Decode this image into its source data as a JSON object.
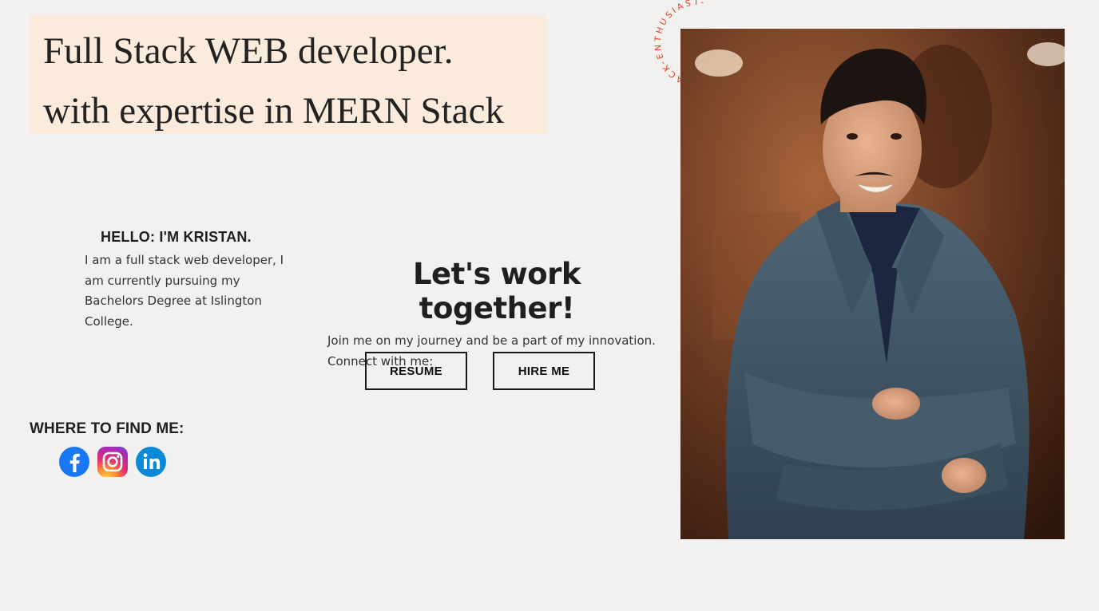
{
  "hero": {
    "line1": "Full Stack WEB developer.",
    "line2": "with expertise in MERN Stack"
  },
  "badge": {
    "text": "MERN STACK-ENTHUSIAST-",
    "color": "#e2401c"
  },
  "intro": {
    "title": "HELLO: I'M KRISTAN.",
    "text": "I am a full stack web developer, I am currently pursuing my Bachelors Degree at Islington College."
  },
  "cta": {
    "title": "Let's work together!",
    "text": "Join me on my journey and be a part of my innovation. Connect with me:",
    "resume_label": "RESUME",
    "hire_label": "HIRE ME"
  },
  "find": {
    "title": "WHERE TO FIND ME:",
    "socials": [
      {
        "icon": "facebook-icon",
        "color": "#1877f2"
      },
      {
        "icon": "instagram-icon",
        "color": "#dd2a7b"
      },
      {
        "icon": "linkedin-icon",
        "color": "#0a8ad6"
      }
    ]
  },
  "colors": {
    "background": "#f3f1f0",
    "headline_bg": "#faebdc",
    "text": "#222222"
  }
}
